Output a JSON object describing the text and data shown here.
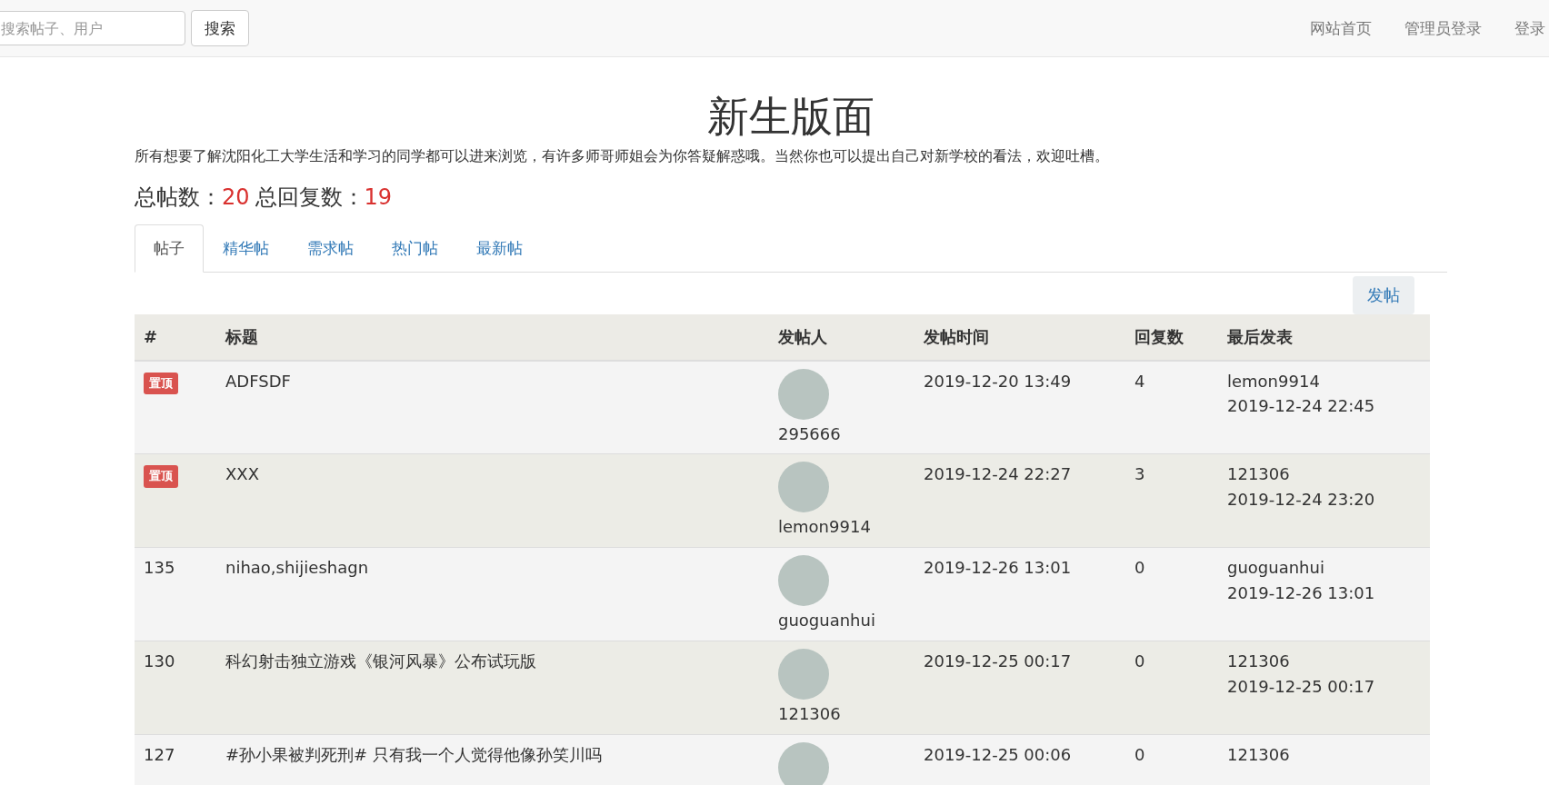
{
  "navbar": {
    "search": {
      "placeholder": "搜索帖子、用户"
    },
    "search_button": "搜索",
    "links": [
      "网站首页",
      "管理员登录",
      "登录"
    ]
  },
  "board": {
    "title": "新生版面",
    "description": "所有想要了解沈阳化工大学生活和学习的同学都可以进来浏览，有许多师哥师姐会为你答疑解惑哦。当然你也可以提出自己对新学校的看法，欢迎吐槽。",
    "stats": [
      {
        "label": "总帖数：",
        "value": "20"
      },
      {
        "label": "总回复数：",
        "value": "19"
      }
    ]
  },
  "tabs": [
    {
      "label": "帖子",
      "selected": true
    },
    {
      "label": "精华帖",
      "selected": false
    },
    {
      "label": "需求帖",
      "selected": false
    },
    {
      "label": "热门帖",
      "selected": false
    },
    {
      "label": "最新帖",
      "selected": false
    }
  ],
  "post_button": "发帖",
  "table": {
    "columns": [
      "#",
      "标题",
      "发帖人",
      "发帖时间",
      "回复数",
      "最后发表"
    ],
    "rows": [
      {
        "kind": "pinned",
        "index": "置顶",
        "title": "ADFSDF",
        "poster": "295666",
        "time": "2019-12-20 13:49",
        "replies": "4",
        "last_user": "lemon9914",
        "last_time": "2019-12-24 22:45"
      },
      {
        "kind": "pinned",
        "index": "置顶",
        "title": "XXX",
        "poster": "lemon9914",
        "time": "2019-12-24 22:27",
        "replies": "3",
        "last_user": "121306",
        "last_time": "2019-12-24 23:20"
      },
      {
        "kind": "normal",
        "index": "135",
        "title": "nihao,shijieshagn",
        "poster": "guoguanhui",
        "time": "2019-12-26 13:01",
        "replies": "0",
        "last_user": "guoguanhui",
        "last_time": "2019-12-26 13:01"
      },
      {
        "kind": "normal",
        "index": "130",
        "title": "科幻射击独立游戏《银河风暴》公布试玩版",
        "poster": "121306",
        "time": "2019-12-25 00:17",
        "replies": "0",
        "last_user": "121306",
        "last_time": "2019-12-25 00:17"
      },
      {
        "kind": "normal",
        "index": "127",
        "title": "#孙小果被判死刑# 只有我一个人觉得他像孙笑川吗",
        "time": "2019-12-25 00:06",
        "replies": "0",
        "last_user": "121306"
      }
    ]
  }
}
